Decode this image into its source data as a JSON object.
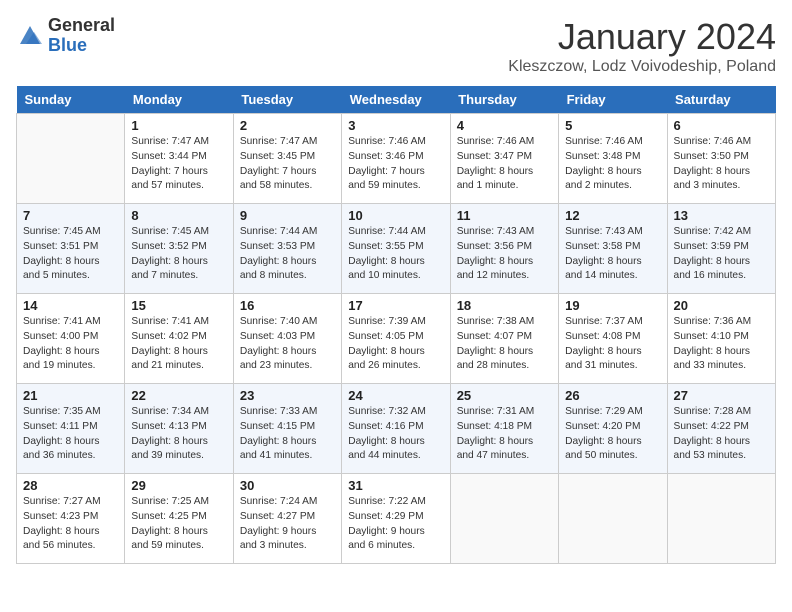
{
  "header": {
    "logo_general": "General",
    "logo_blue": "Blue",
    "month_title": "January 2024",
    "location": "Kleszczow, Lodz Voivodeship, Poland"
  },
  "days_of_week": [
    "Sunday",
    "Monday",
    "Tuesday",
    "Wednesday",
    "Thursday",
    "Friday",
    "Saturday"
  ],
  "weeks": [
    [
      {
        "day": "",
        "info": ""
      },
      {
        "day": "1",
        "info": "Sunrise: 7:47 AM\nSunset: 3:44 PM\nDaylight: 7 hours\nand 57 minutes."
      },
      {
        "day": "2",
        "info": "Sunrise: 7:47 AM\nSunset: 3:45 PM\nDaylight: 7 hours\nand 58 minutes."
      },
      {
        "day": "3",
        "info": "Sunrise: 7:46 AM\nSunset: 3:46 PM\nDaylight: 7 hours\nand 59 minutes."
      },
      {
        "day": "4",
        "info": "Sunrise: 7:46 AM\nSunset: 3:47 PM\nDaylight: 8 hours\nand 1 minute."
      },
      {
        "day": "5",
        "info": "Sunrise: 7:46 AM\nSunset: 3:48 PM\nDaylight: 8 hours\nand 2 minutes."
      },
      {
        "day": "6",
        "info": "Sunrise: 7:46 AM\nSunset: 3:50 PM\nDaylight: 8 hours\nand 3 minutes."
      }
    ],
    [
      {
        "day": "7",
        "info": "Sunrise: 7:45 AM\nSunset: 3:51 PM\nDaylight: 8 hours\nand 5 minutes."
      },
      {
        "day": "8",
        "info": "Sunrise: 7:45 AM\nSunset: 3:52 PM\nDaylight: 8 hours\nand 7 minutes."
      },
      {
        "day": "9",
        "info": "Sunrise: 7:44 AM\nSunset: 3:53 PM\nDaylight: 8 hours\nand 8 minutes."
      },
      {
        "day": "10",
        "info": "Sunrise: 7:44 AM\nSunset: 3:55 PM\nDaylight: 8 hours\nand 10 minutes."
      },
      {
        "day": "11",
        "info": "Sunrise: 7:43 AM\nSunset: 3:56 PM\nDaylight: 8 hours\nand 12 minutes."
      },
      {
        "day": "12",
        "info": "Sunrise: 7:43 AM\nSunset: 3:58 PM\nDaylight: 8 hours\nand 14 minutes."
      },
      {
        "day": "13",
        "info": "Sunrise: 7:42 AM\nSunset: 3:59 PM\nDaylight: 8 hours\nand 16 minutes."
      }
    ],
    [
      {
        "day": "14",
        "info": "Sunrise: 7:41 AM\nSunset: 4:00 PM\nDaylight: 8 hours\nand 19 minutes."
      },
      {
        "day": "15",
        "info": "Sunrise: 7:41 AM\nSunset: 4:02 PM\nDaylight: 8 hours\nand 21 minutes."
      },
      {
        "day": "16",
        "info": "Sunrise: 7:40 AM\nSunset: 4:03 PM\nDaylight: 8 hours\nand 23 minutes."
      },
      {
        "day": "17",
        "info": "Sunrise: 7:39 AM\nSunset: 4:05 PM\nDaylight: 8 hours\nand 26 minutes."
      },
      {
        "day": "18",
        "info": "Sunrise: 7:38 AM\nSunset: 4:07 PM\nDaylight: 8 hours\nand 28 minutes."
      },
      {
        "day": "19",
        "info": "Sunrise: 7:37 AM\nSunset: 4:08 PM\nDaylight: 8 hours\nand 31 minutes."
      },
      {
        "day": "20",
        "info": "Sunrise: 7:36 AM\nSunset: 4:10 PM\nDaylight: 8 hours\nand 33 minutes."
      }
    ],
    [
      {
        "day": "21",
        "info": "Sunrise: 7:35 AM\nSunset: 4:11 PM\nDaylight: 8 hours\nand 36 minutes."
      },
      {
        "day": "22",
        "info": "Sunrise: 7:34 AM\nSunset: 4:13 PM\nDaylight: 8 hours\nand 39 minutes."
      },
      {
        "day": "23",
        "info": "Sunrise: 7:33 AM\nSunset: 4:15 PM\nDaylight: 8 hours\nand 41 minutes."
      },
      {
        "day": "24",
        "info": "Sunrise: 7:32 AM\nSunset: 4:16 PM\nDaylight: 8 hours\nand 44 minutes."
      },
      {
        "day": "25",
        "info": "Sunrise: 7:31 AM\nSunset: 4:18 PM\nDaylight: 8 hours\nand 47 minutes."
      },
      {
        "day": "26",
        "info": "Sunrise: 7:29 AM\nSunset: 4:20 PM\nDaylight: 8 hours\nand 50 minutes."
      },
      {
        "day": "27",
        "info": "Sunrise: 7:28 AM\nSunset: 4:22 PM\nDaylight: 8 hours\nand 53 minutes."
      }
    ],
    [
      {
        "day": "28",
        "info": "Sunrise: 7:27 AM\nSunset: 4:23 PM\nDaylight: 8 hours\nand 56 minutes."
      },
      {
        "day": "29",
        "info": "Sunrise: 7:25 AM\nSunset: 4:25 PM\nDaylight: 8 hours\nand 59 minutes."
      },
      {
        "day": "30",
        "info": "Sunrise: 7:24 AM\nSunset: 4:27 PM\nDaylight: 9 hours\nand 3 minutes."
      },
      {
        "day": "31",
        "info": "Sunrise: 7:22 AM\nSunset: 4:29 PM\nDaylight: 9 hours\nand 6 minutes."
      },
      {
        "day": "",
        "info": ""
      },
      {
        "day": "",
        "info": ""
      },
      {
        "day": "",
        "info": ""
      }
    ]
  ]
}
